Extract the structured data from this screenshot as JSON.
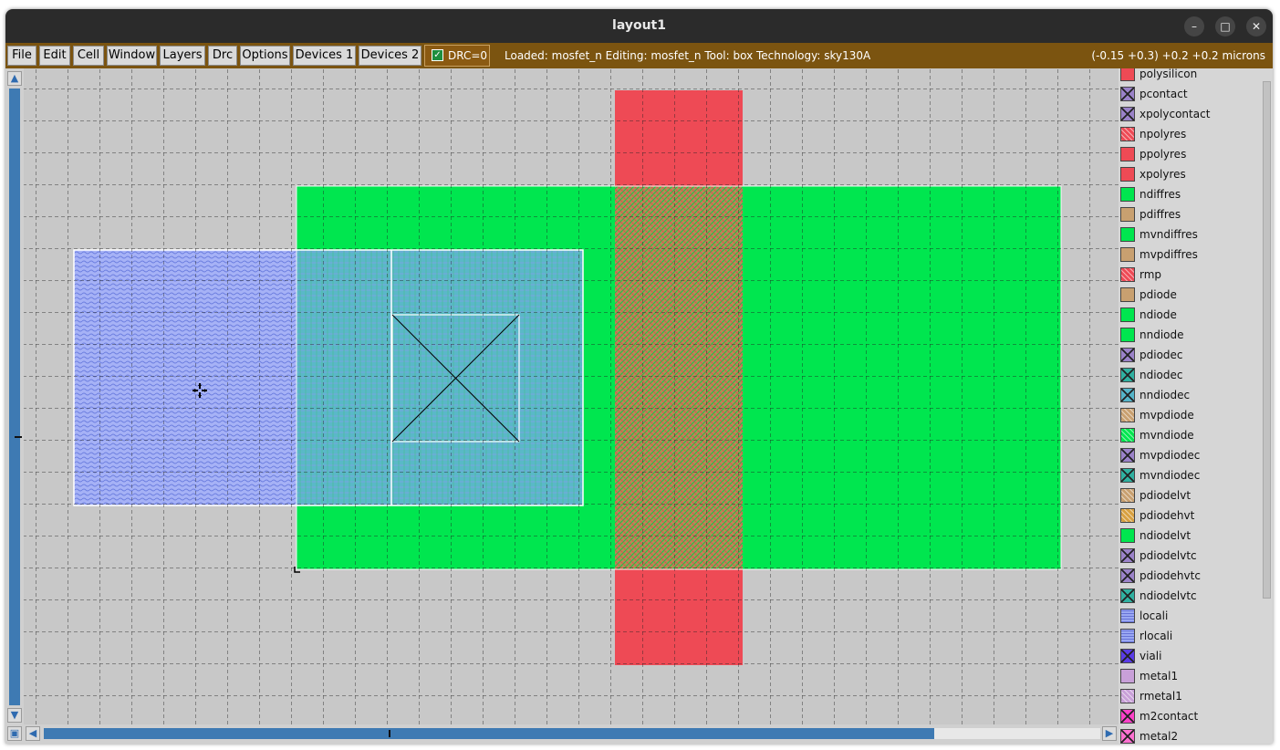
{
  "window": {
    "title": "layout1",
    "controls": {
      "minimize": "–",
      "maximize": "□",
      "close": "✕"
    }
  },
  "menu": {
    "items": [
      "File",
      "Edit",
      "Cell",
      "Window",
      "Layers",
      "Drc",
      "Options",
      "Devices 1",
      "Devices 2"
    ],
    "drc_label": "DRC=0",
    "drc_checked": true,
    "status": "Loaded: mosfet_n Editing: mosfet_n Tool: box  Technology: sky130A",
    "coordinates": "(-0.15 +0.3) +0.2 +0.2 microns"
  },
  "colors": {
    "menubar": "#7b5410",
    "titlebar": "#2b2b2b",
    "canvas_bg": "#c8c8c8",
    "poly": "#ee4a55",
    "diff": "#00e64f",
    "locali": "#9aa8f2",
    "licon": "#55b4c8",
    "gate": "#a89050",
    "scroll": "#3e7ab3"
  },
  "canvas": {
    "cursor": "crosshair-icon"
  },
  "layers": [
    {
      "name": "polysilicon",
      "fill": "#ee4a55",
      "pattern": "solid"
    },
    {
      "name": "pcontact",
      "fill": "#9a82c8",
      "pattern": "x"
    },
    {
      "name": "xpolycontact",
      "fill": "#9a82c8",
      "pattern": "x"
    },
    {
      "name": "npolyres",
      "fill": "#ee4a55",
      "pattern": "hatch"
    },
    {
      "name": "ppolyres",
      "fill": "#ee4a55",
      "pattern": "solid"
    },
    {
      "name": "xpolyres",
      "fill": "#ee4a55",
      "pattern": "solid"
    },
    {
      "name": "ndiffres",
      "fill": "#00e64f",
      "pattern": "solid"
    },
    {
      "name": "pdiffres",
      "fill": "#c8a070",
      "pattern": "solid"
    },
    {
      "name": "mvndiffres",
      "fill": "#00e64f",
      "pattern": "solid"
    },
    {
      "name": "mvpdiffres",
      "fill": "#c8a070",
      "pattern": "solid"
    },
    {
      "name": "rmp",
      "fill": "#ee4a55",
      "pattern": "hatch"
    },
    {
      "name": "pdiode",
      "fill": "#c8a070",
      "pattern": "solid"
    },
    {
      "name": "ndiode",
      "fill": "#00e64f",
      "pattern": "solid"
    },
    {
      "name": "nndiode",
      "fill": "#00e64f",
      "pattern": "solid"
    },
    {
      "name": "pdiodec",
      "fill": "#9a82c8",
      "pattern": "x"
    },
    {
      "name": "ndiodec",
      "fill": "#30b0a0",
      "pattern": "x"
    },
    {
      "name": "nndiodec",
      "fill": "#55b4c8",
      "pattern": "x"
    },
    {
      "name": "mvpdiode",
      "fill": "#c8a070",
      "pattern": "hatch"
    },
    {
      "name": "mvndiode",
      "fill": "#00e64f",
      "pattern": "hatch"
    },
    {
      "name": "mvpdiodec",
      "fill": "#9a82c8",
      "pattern": "x"
    },
    {
      "name": "mvndiodec",
      "fill": "#30b0a0",
      "pattern": "x"
    },
    {
      "name": "pdiodelvt",
      "fill": "#c8a070",
      "pattern": "hatch"
    },
    {
      "name": "pdiodehvt",
      "fill": "#d8a040",
      "pattern": "hatch"
    },
    {
      "name": "ndiodelvt",
      "fill": "#00e64f",
      "pattern": "solid"
    },
    {
      "name": "pdiodelvtc",
      "fill": "#9a82c8",
      "pattern": "x"
    },
    {
      "name": "pdiodehvtc",
      "fill": "#9a82c8",
      "pattern": "x"
    },
    {
      "name": "ndiodelvtc",
      "fill": "#30b0a0",
      "pattern": "x"
    },
    {
      "name": "locali",
      "fill": "#9aa8f2",
      "pattern": "wave"
    },
    {
      "name": "rlocali",
      "fill": "#9aa8f2",
      "pattern": "wave"
    },
    {
      "name": "viali",
      "fill": "#5a3ce6",
      "pattern": "x"
    },
    {
      "name": "metal1",
      "fill": "#c8a0d8",
      "pattern": "solid"
    },
    {
      "name": "rmetal1",
      "fill": "#c8a0d8",
      "pattern": "hatch"
    },
    {
      "name": "m2contact",
      "fill": "#ff40c8",
      "pattern": "x"
    },
    {
      "name": "metal2",
      "fill": "#ff70d0",
      "pattern": "x"
    }
  ]
}
